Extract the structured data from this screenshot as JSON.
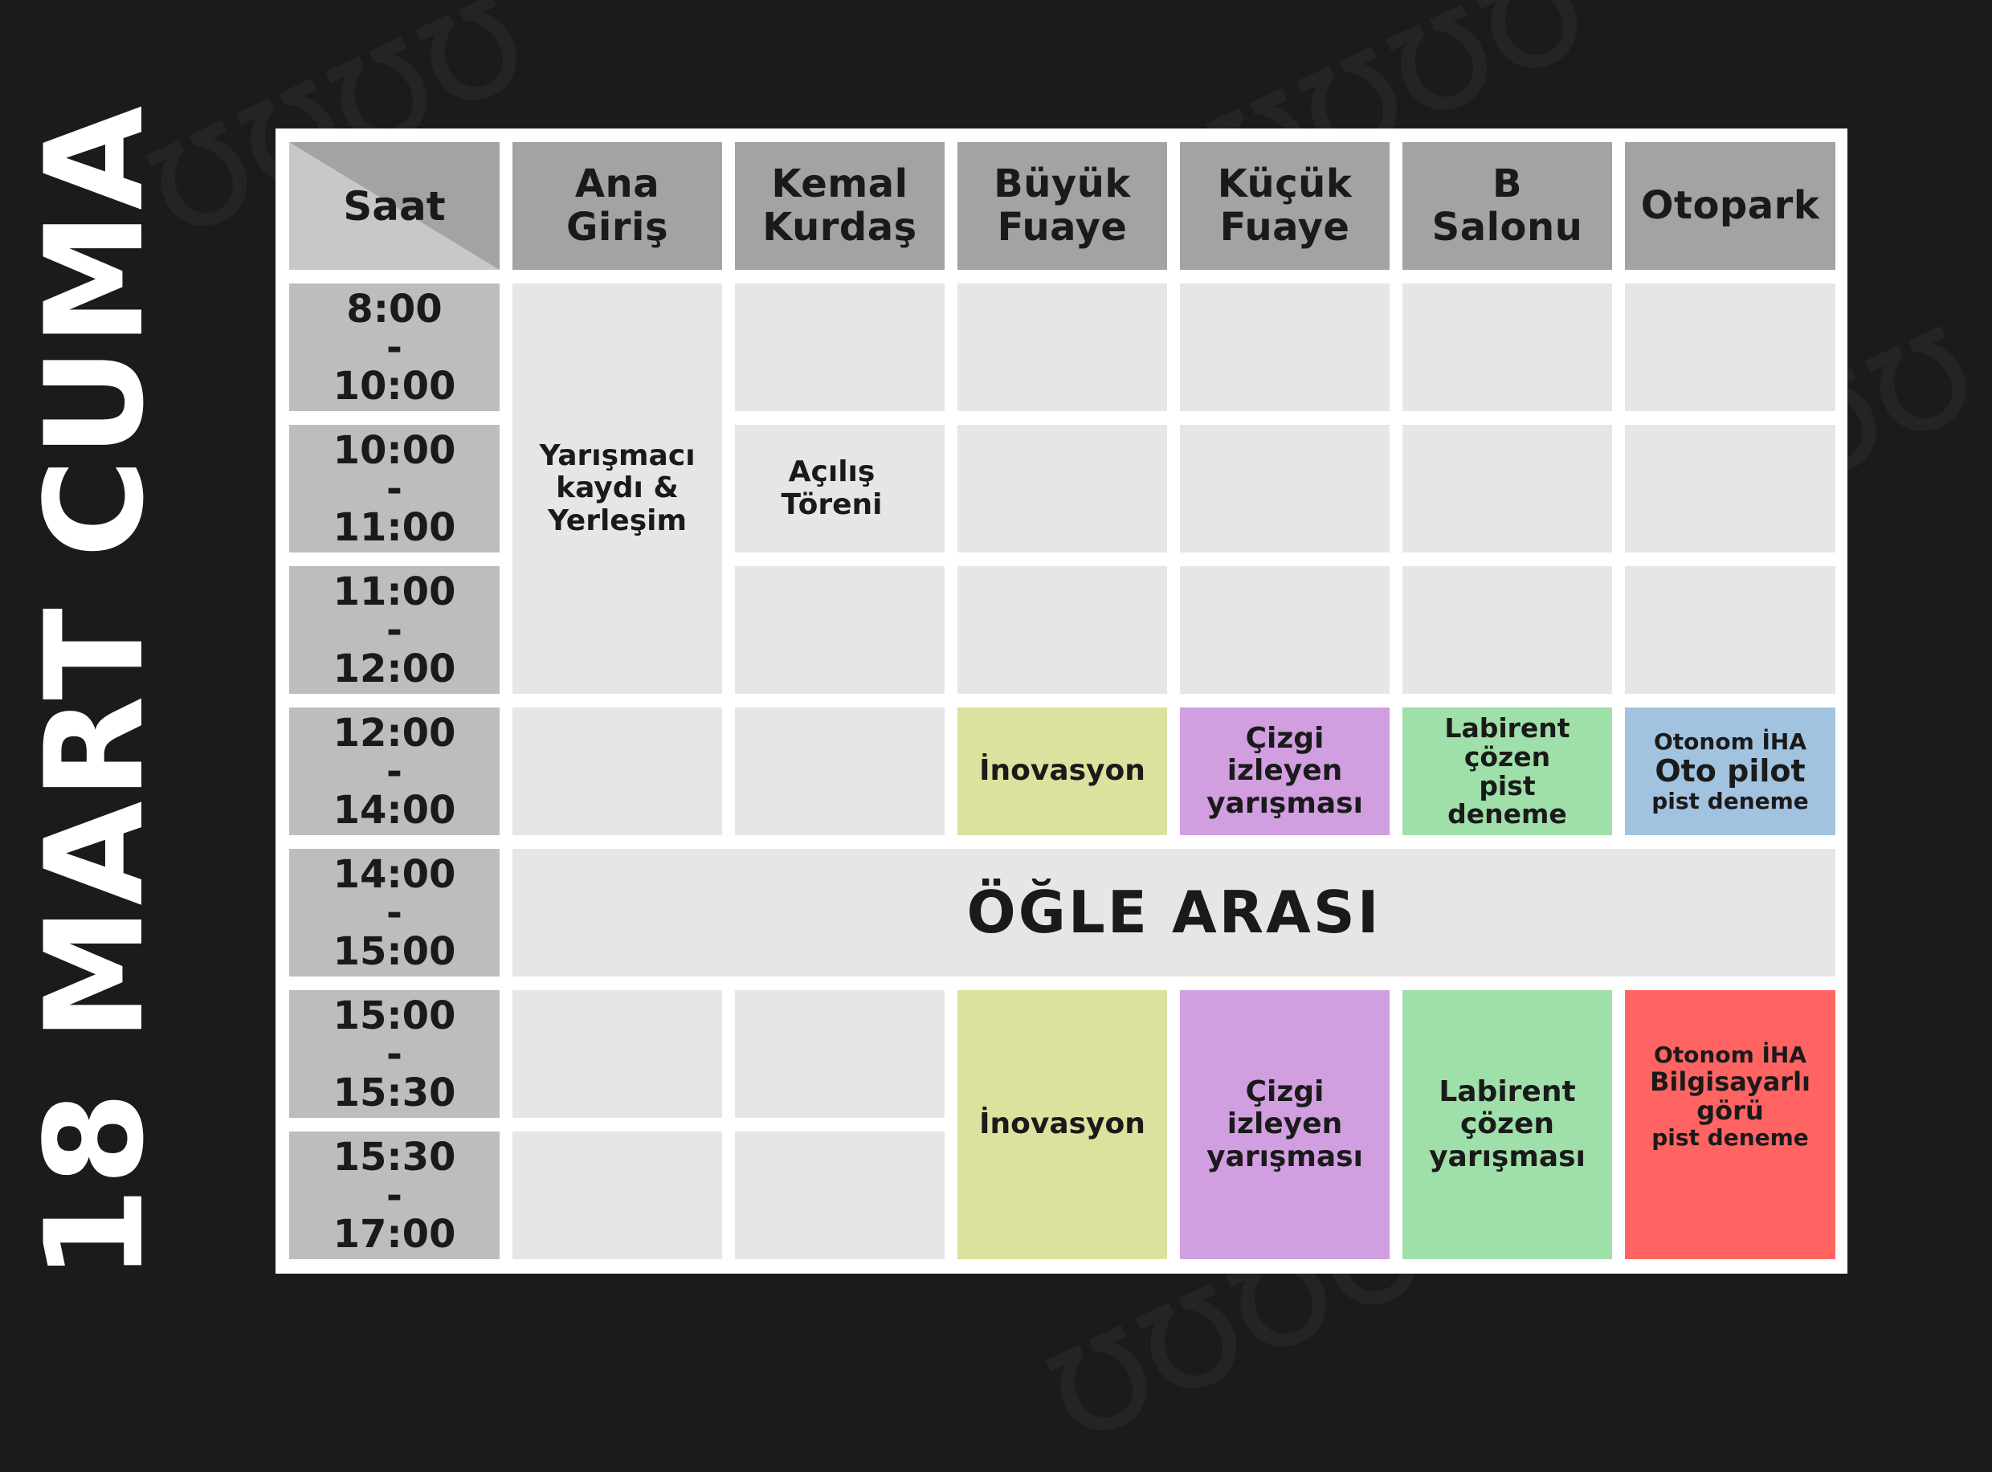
{
  "page": {
    "title": "18 MART CUMA"
  },
  "headers": [
    "Saat",
    "Ana\nGiriş",
    "Kemal\nKurdaş",
    "Büyük\nFuaye",
    "Küçük\nFuaye",
    "B\nSalonu",
    "Otopark"
  ],
  "times": [
    "8:00\n-\n10:00",
    "10:00\n-\n11:00",
    "11:00\n-\n12:00",
    "12:00\n-\n14:00",
    "14:00\n-\n15:00",
    "15:00\n-\n15:30",
    "15:30\n-\n17:00"
  ],
  "events": {
    "kayit": "Yarışmacı\nkaydı &\nYerleşim",
    "acilis": "Açılış\nTöreni",
    "inovasyon_1": "İnovasyon",
    "cizgi_1": "Çizgi\nizleyen\nyarışması",
    "labirent_1": "Labirent\nçözen\npist\ndeneme",
    "otonom_1_title": "Otonom İHA",
    "otonom_1_sub": "Oto pilot",
    "otonom_1_note": "pist deneme",
    "ogle_arasi": "ÖĞLE ARASI",
    "inovasyon_2": "İnovasyon",
    "cizgi_2": "Çizgi\nizleyen\nyarışması",
    "labirent_2": "Labirent\nçözen\nyarışması",
    "otonom_2_title": "Otonom İHA",
    "otonom_2_sub": "Bilgisayarlı\ngörü",
    "otonom_2_note": "pist deneme"
  },
  "colors": {
    "background": "#1b1b1b",
    "header": "#a3a3a3",
    "time": "#bdbdbd",
    "empty": "#e6e6e6",
    "inovasyon": "#dde19e",
    "cizgi": "#d19ee0",
    "labirent": "#9fdfa9",
    "otonom_1": "#a2c3e0",
    "otonom_2": "#ff6462"
  }
}
